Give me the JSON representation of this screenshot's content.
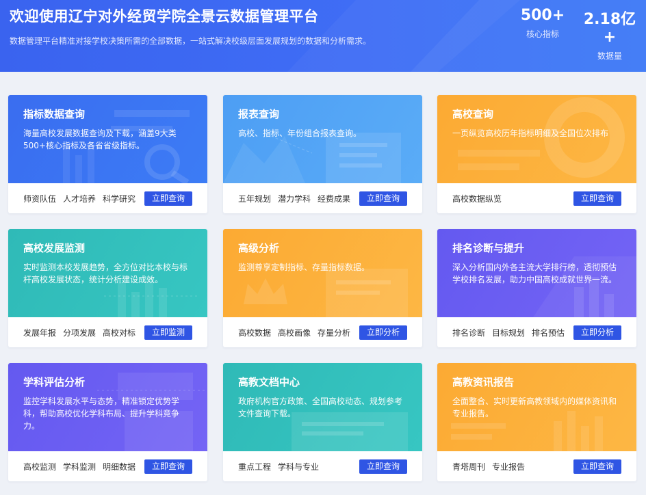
{
  "header": {
    "title": "欢迎使用辽宁对外经贸学院全景云数据管理平台",
    "subtitle": "数据管理平台精准对接学校决策所需的全部数据，一站式解决校级层面发展规划的数据和分析需求。",
    "stats": [
      {
        "value": "500+",
        "label": "核心指标"
      },
      {
        "value": "2.18亿+",
        "label": "数据量"
      }
    ]
  },
  "colors": {
    "button": "#2f55e4",
    "blue": "#3a6df0",
    "sky": "#4d9ef4",
    "orange": "#fcaa33",
    "teal": "#2fbab7",
    "purple": "#6459f0"
  },
  "cards": [
    {
      "title": "指标数据查询",
      "desc": "海量高校发展数据查询及下载，涵盖9大类500+核心指标及各省省级指标。",
      "tags": [
        "师资队伍",
        "人才培养",
        "科学研究"
      ],
      "button": "立即查询",
      "theme": "blue",
      "icon": "magnifier-chart-illustration"
    },
    {
      "title": "报表查询",
      "desc": "高校、指标、年份组合报表查询。",
      "tags": [
        "五年规划",
        "潜力学科",
        "经费成果"
      ],
      "button": "立即查询",
      "theme": "sky",
      "icon": "report-illustration"
    },
    {
      "title": "高校查询",
      "desc": "一页纵览高校历年指标明细及全国位次排布",
      "tags": [
        "高校数据纵览"
      ],
      "button": "立即查询",
      "theme": "orange",
      "icon": "pie-chart-illustration"
    },
    {
      "title": "高校发展监测",
      "desc": "实时监测本校发展趋势，全方位对比本校与标杆高校发展状态，统计分析建设成效。",
      "tags": [
        "发展年报",
        "分项发展",
        "高校对标"
      ],
      "button": "立即监测",
      "theme": "teal",
      "icon": "monitor-illustration"
    },
    {
      "title": "高级分析",
      "desc": "监测尊享定制指标、存量指标数据。",
      "tags": [
        "高校数据",
        "高校画像",
        "存量分析"
      ],
      "button": "立即分析",
      "theme": "orange",
      "icon": "crown-illustration"
    },
    {
      "title": "排名诊断与提升",
      "desc": "深入分析国内外各主流大学排行榜，透彻预估学校排名发展，助力中国高校成就世界一流。",
      "tags": [
        "排名诊断",
        "目标规划",
        "排名预估"
      ],
      "button": "立即分析",
      "theme": "purple",
      "icon": "ranking-illustration"
    },
    {
      "title": "学科评估分析",
      "desc": "监控学科发展水平与态势，精准锁定优势学科，帮助高校优化学科布局、提升学科竞争力。",
      "tags": [
        "高校监测",
        "学科监测",
        "明细数据"
      ],
      "button": "立即查询",
      "theme": "purple",
      "icon": "discipline-illustration"
    },
    {
      "title": "高教文档中心",
      "desc": "政府机构官方政策、全国高校动态、规划参考文件查询下载。",
      "tags": [
        "重点工程",
        "学科与专业"
      ],
      "button": "立即查询",
      "theme": "teal",
      "icon": "document-illustration"
    },
    {
      "title": "高教资讯报告",
      "desc": "全面整合、实时更新高教领域内的媒体资讯和专业报告。",
      "tags": [
        "青塔周刊",
        "专业报告"
      ],
      "button": "立即查询",
      "theme": "orange",
      "icon": "news-illustration"
    }
  ]
}
